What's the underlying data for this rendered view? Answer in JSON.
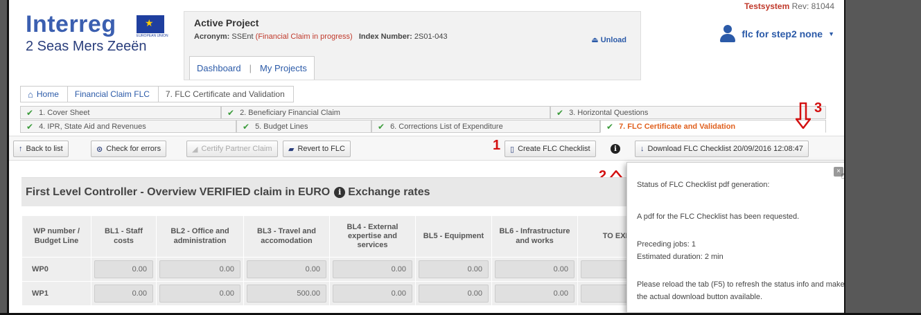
{
  "header": {
    "logo_word": "Interreg",
    "logo_sub": "2 Seas Mers Zeeën",
    "eu_small": "EUROPEAN UNION",
    "project": {
      "title": "Active Project",
      "acronym_label": "Acronym:",
      "acronym": "SSEnt",
      "status": "(Financial Claim in progress)",
      "index_label": "Index Number:",
      "index": "2S01-043",
      "unload": "Unload"
    },
    "nav": {
      "dashboard": "Dashboard",
      "sep": "|",
      "my_projects": "My Projects"
    },
    "testsystem": "Testsystem",
    "rev": "Rev: 81044",
    "user": "flc for step2 none"
  },
  "breadcrumb": {
    "home": "Home",
    "claim": "Financial Claim FLC",
    "current": "7. FLC Certificate and Validation"
  },
  "tabs": [
    {
      "label": "1. Cover Sheet"
    },
    {
      "label": "2. Beneficiary Financial Claim"
    },
    {
      "label": "3. Horizontal Questions"
    },
    {
      "label": "4. IPR, State Aid and Revenues"
    },
    {
      "label": "5. Budget Lines"
    },
    {
      "label": "6. Corrections List of Expenditure"
    },
    {
      "label": "7. FLC Certificate and Validation"
    }
  ],
  "toolbar": {
    "back": "Back to list",
    "check": "Check for errors",
    "certify": "Certify Partner Claim",
    "revert": "Revert to FLC",
    "create": "Create FLC Checklist",
    "download": "Download FLC Checklist 20/09/2016 12:08:47"
  },
  "markers": {
    "one": "1",
    "two": "2",
    "three": "3"
  },
  "overview": {
    "title": "First Level Controller - Overview VERIFIED claim in EURO",
    "link": "Exchange rates"
  },
  "table": {
    "headers": [
      "WP number / Budget Line",
      "BL1 - Staff costs",
      "BL2 - Office and administration",
      "BL3 - Travel and accomodation",
      "BL4 - External expertise and services",
      "BL5 - Equipment",
      "BL6 - Infrastructure and works",
      "TO EXPE"
    ],
    "rows": [
      {
        "label": "WP0",
        "values": [
          "0.00",
          "0.00",
          "0.00",
          "0.00",
          "0.00",
          "0.00"
        ]
      },
      {
        "label": "WP1",
        "values": [
          "0.00",
          "0.00",
          "500.00",
          "0.00",
          "0.00",
          "0.00"
        ]
      }
    ]
  },
  "popup": {
    "l1": "Status of FLC Checklist pdf generation:",
    "l2": "A pdf for the FLC Checklist has been requested.",
    "l3": "Preceding jobs: 1",
    "l4": "Estimated duration: 2 min",
    "l5": "Please reload the tab (F5) to refresh the status info and make the actual download button available.",
    "close": "×"
  }
}
